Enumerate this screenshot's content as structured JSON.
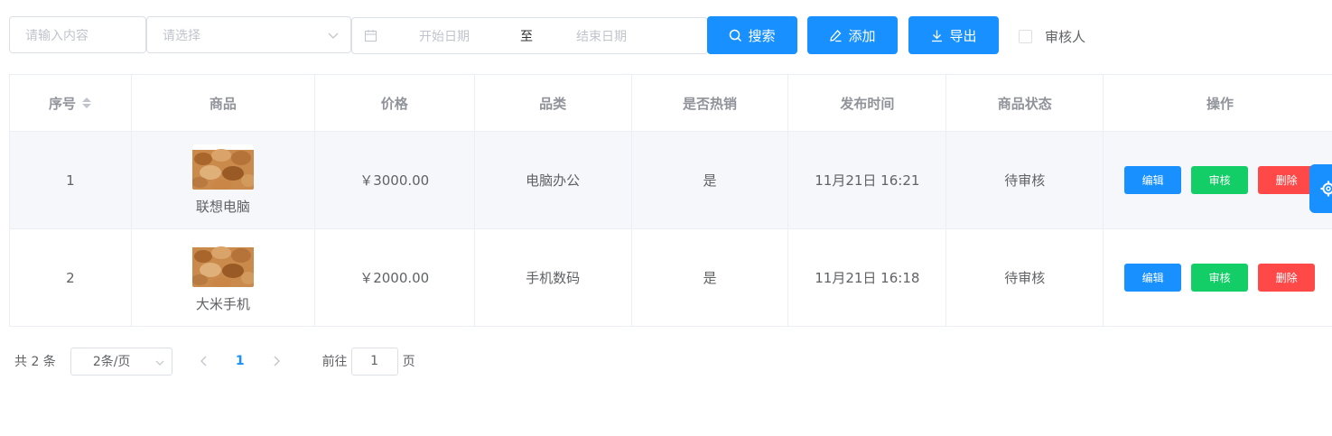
{
  "toolbar": {
    "keyword_placeholder": "请输入内容",
    "select_placeholder": "请选择",
    "start_date_placeholder": "开始日期",
    "range_separator": "至",
    "end_date_placeholder": "结束日期",
    "search_label": "搜索",
    "add_label": "添加",
    "export_label": "导出",
    "reviewer_checkbox_label": "审核人",
    "reviewer_checked": false
  },
  "table": {
    "columns": [
      "序号",
      "商品",
      "价格",
      "品类",
      "是否热销",
      "发布时间",
      "商品状态",
      "操作"
    ],
    "rows": [
      {
        "index": "1",
        "name": "联想电脑",
        "price": "￥3000.00",
        "category": "电脑办公",
        "hot": "是",
        "time": "11月21日 16:21",
        "status": "待审核"
      },
      {
        "index": "2",
        "name": "大米手机",
        "price": "￥2000.00",
        "category": "手机数码",
        "hot": "是",
        "time": "11月21日 16:18",
        "status": "待审核"
      }
    ],
    "actions": {
      "edit": "编辑",
      "review": "审核",
      "delete": "删除"
    }
  },
  "pagination": {
    "total_text": "共 2 条",
    "page_size": "2条/页",
    "current_page": "1",
    "goto_prefix": "前往",
    "goto_value": "1",
    "goto_suffix": "页"
  },
  "colors": {
    "primary": "#1890ff",
    "success": "#13ce66",
    "danger": "#ff4949"
  },
  "icons": [
    "search-icon",
    "edit-icon",
    "download-icon",
    "calendar-icon",
    "chevron-down-icon",
    "sort-icon",
    "gear-icon",
    "chevron-left-icon",
    "chevron-right-icon"
  ]
}
